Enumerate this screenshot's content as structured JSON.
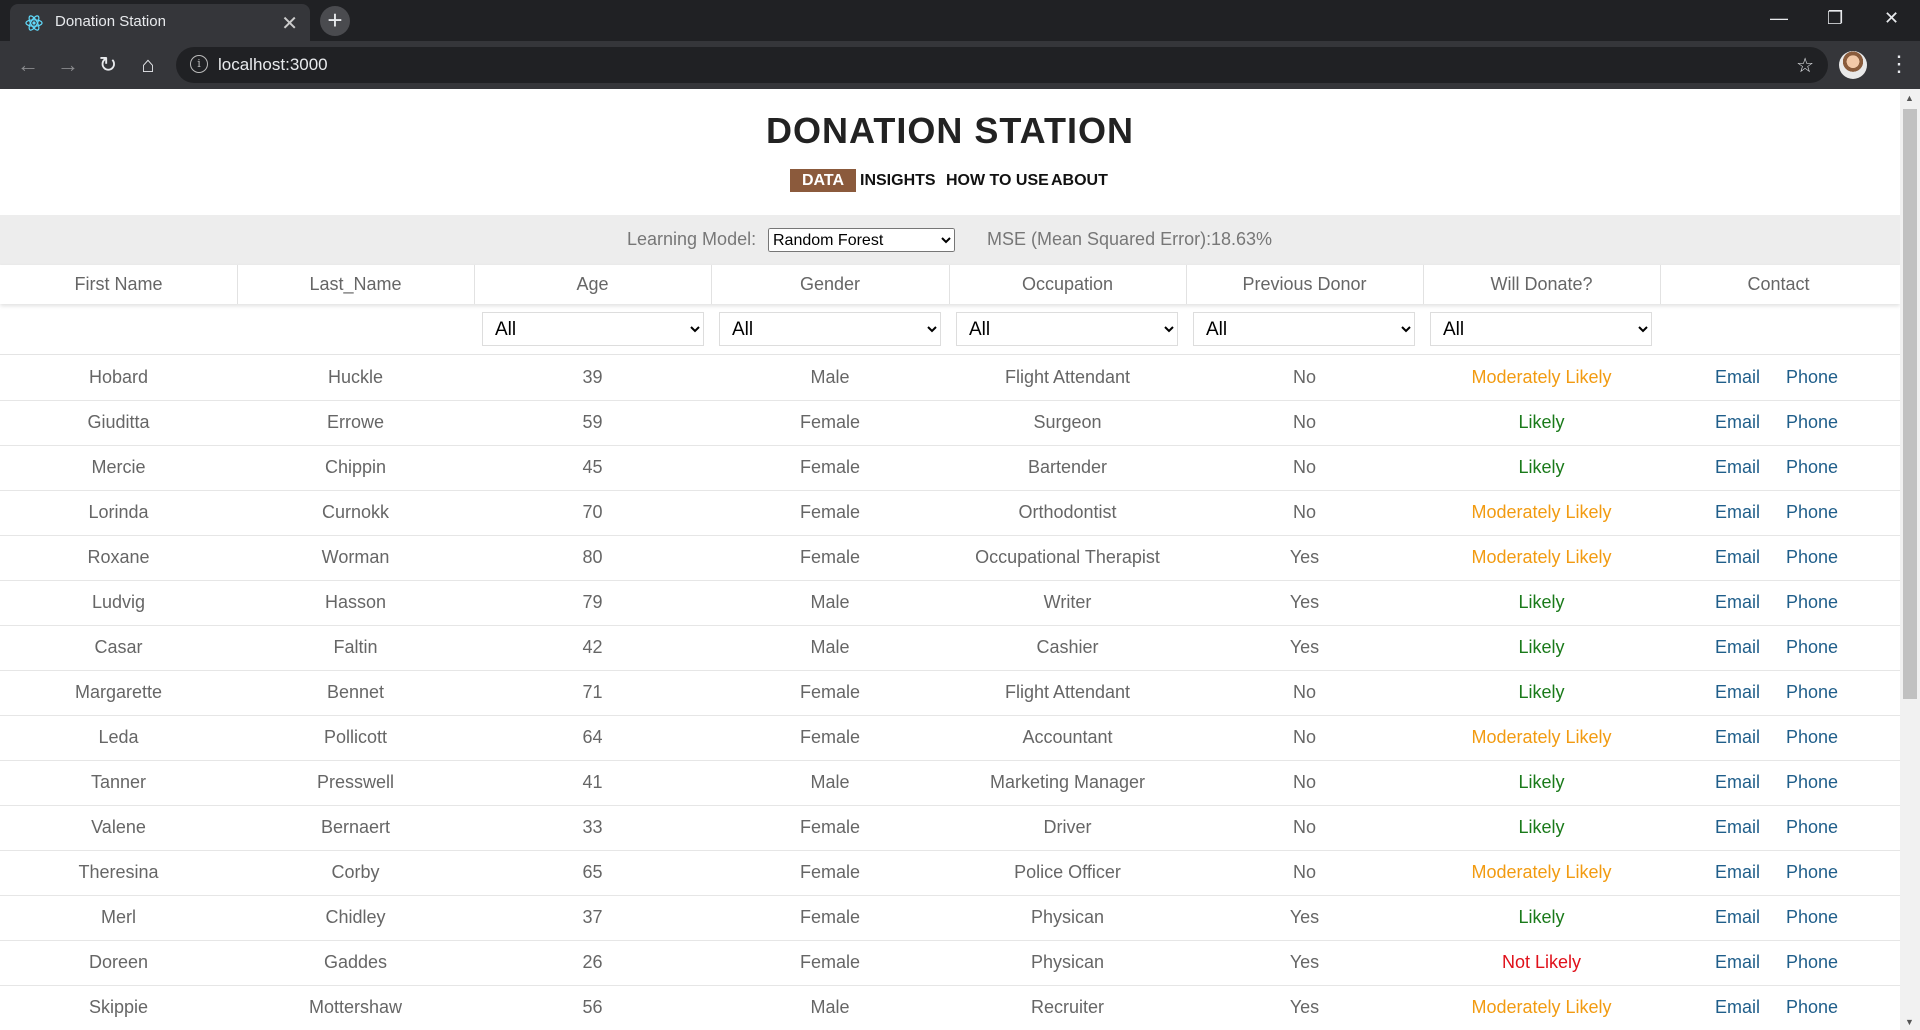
{
  "browser": {
    "tab_title": "Donation Station",
    "url": "localhost:3000"
  },
  "app": {
    "title": "DONATION STATION",
    "nav": [
      "DATA",
      "INSIGHTS",
      "HOW TO USE",
      "ABOUT"
    ],
    "active_nav": "DATA"
  },
  "model_bar": {
    "learning_model_label": "Learning Model:",
    "learning_model_value": "Random Forest",
    "mse_label": "MSE (Mean Squared Error):",
    "mse_value": "18.63%"
  },
  "table": {
    "headers": [
      "First Name",
      "Last_Name",
      "Age",
      "Gender",
      "Occupation",
      "Previous Donor",
      "Will Donate?",
      "Contact"
    ],
    "filters": {
      "age": "All",
      "gender": "All",
      "occupation": "All",
      "previous_donor": "All",
      "will_donate": "All"
    },
    "contact_labels": {
      "email": "Email",
      "phone": "Phone"
    },
    "rows": [
      [
        "Hobard",
        "Huckle",
        "39",
        "Male",
        "Flight Attendant",
        "No",
        "Moderately Likely"
      ],
      [
        "Giuditta",
        "Errowe",
        "59",
        "Female",
        "Surgeon",
        "No",
        "Likely"
      ],
      [
        "Mercie",
        "Chippin",
        "45",
        "Female",
        "Bartender",
        "No",
        "Likely"
      ],
      [
        "Lorinda",
        "Curnokk",
        "70",
        "Female",
        "Orthodontist",
        "No",
        "Moderately Likely"
      ],
      [
        "Roxane",
        "Worman",
        "80",
        "Female",
        "Occupational Therapist",
        "Yes",
        "Moderately Likely"
      ],
      [
        "Ludvig",
        "Hasson",
        "79",
        "Male",
        "Writer",
        "Yes",
        "Likely"
      ],
      [
        "Casar",
        "Faltin",
        "42",
        "Male",
        "Cashier",
        "Yes",
        "Likely"
      ],
      [
        "Margarette",
        "Bennet",
        "71",
        "Female",
        "Flight Attendant",
        "No",
        "Likely"
      ],
      [
        "Leda",
        "Pollicott",
        "64",
        "Female",
        "Accountant",
        "No",
        "Moderately Likely"
      ],
      [
        "Tanner",
        "Presswell",
        "41",
        "Male",
        "Marketing Manager",
        "No",
        "Likely"
      ],
      [
        "Valene",
        "Bernaert",
        "33",
        "Female",
        "Driver",
        "No",
        "Likely"
      ],
      [
        "Theresina",
        "Corby",
        "65",
        "Female",
        "Police Officer",
        "No",
        "Moderately Likely"
      ],
      [
        "Merl",
        "Chidley",
        "37",
        "Female",
        "Physican",
        "Yes",
        "Likely"
      ],
      [
        "Doreen",
        "Gaddes",
        "26",
        "Female",
        "Physican",
        "Yes",
        "Not Likely"
      ],
      [
        "Skippie",
        "Mottershaw",
        "56",
        "Male",
        "Recruiter",
        "Yes",
        "Moderately Likely"
      ]
    ]
  },
  "colors": {
    "likely": "#1a7a1a",
    "moderately_likely": "#f29b11",
    "not_likely": "#e0101a",
    "nav_active_bg": "#8b5a3c",
    "link": "#1f5e8a"
  }
}
